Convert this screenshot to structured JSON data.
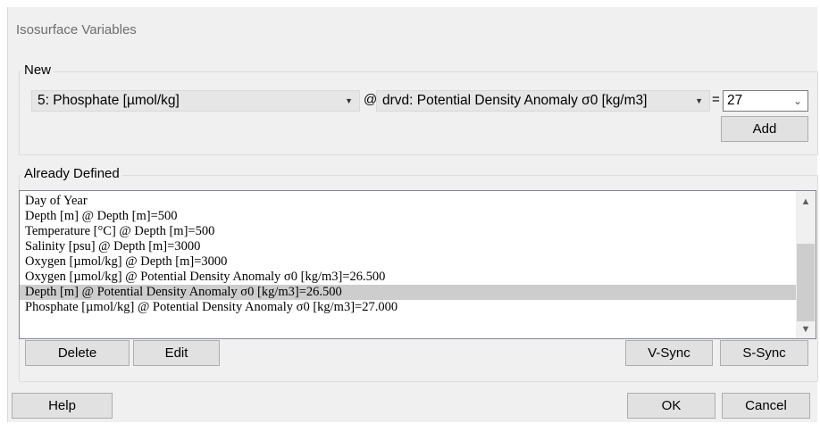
{
  "window": {
    "title": "Isosurface Variables"
  },
  "new_group": {
    "label": "New",
    "variable": "5: Phosphate [µmol/kg]",
    "at_symbol": "@",
    "surface": "drvd: Potential Density Anomaly σ0 [kg/m3]",
    "equals_symbol": "=",
    "value": "27",
    "add_label": "Add"
  },
  "defined_group": {
    "label": "Already Defined",
    "items": [
      "Day of Year",
      "Depth [m] @ Depth [m]=500",
      "Temperature [°C] @ Depth [m]=500",
      "Salinity [psu] @ Depth [m]=3000",
      "Oxygen [µmol/kg] @ Depth [m]=3000",
      "Oxygen [µmol/kg] @ Potential Density Anomaly σ0 [kg/m3]=26.500",
      "Depth [m] @ Potential Density Anomaly σ0 [kg/m3]=26.500",
      "Phosphate [µmol/kg] @ Potential Density Anomaly σ0 [kg/m3]=27.000"
    ],
    "selected_index": 6,
    "delete_label": "Delete",
    "edit_label": "Edit",
    "vsync_label": "V-Sync",
    "ssync_label": "S-Sync"
  },
  "footer": {
    "help_label": "Help",
    "ok_label": "OK",
    "cancel_label": "Cancel"
  },
  "icons": {
    "dropdown": "caret-down-icon",
    "chevron": "chevron-down-icon",
    "scroll_up": "scroll-up-arrow-icon",
    "scroll_down": "scroll-down-arrow-icon"
  },
  "colors": {
    "background": "#f0f0f0",
    "selection": "#cdcdcd",
    "button": "#e1e1e1"
  }
}
